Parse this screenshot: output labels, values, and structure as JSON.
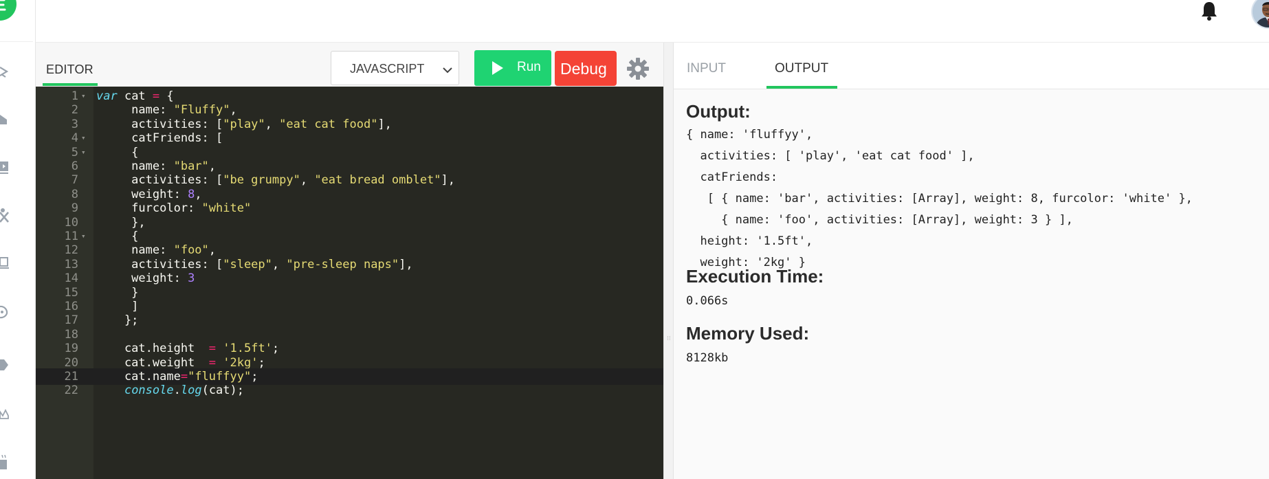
{
  "header": {
    "bell_icon": "bell-icon",
    "avatar_icon": "user-avatar"
  },
  "rail": {
    "icons": [
      "logo-icon",
      "rocket-icon",
      "home-icon",
      "video-icon",
      "tools-icon",
      "laptop-icon",
      "gauge-icon",
      "tag-icon",
      "crown-icon",
      "coffee-icon"
    ]
  },
  "editor": {
    "tab_label": "EDITOR",
    "language": "JAVASCRIPT",
    "run_label": "Run",
    "debug_label": "Debug",
    "lines": [
      {
        "n": "1",
        "fold": true
      },
      {
        "n": "2"
      },
      {
        "n": "3"
      },
      {
        "n": "4",
        "fold": true
      },
      {
        "n": "5",
        "fold": true
      },
      {
        "n": "6"
      },
      {
        "n": "7"
      },
      {
        "n": "8"
      },
      {
        "n": "9"
      },
      {
        "n": "10"
      },
      {
        "n": "11",
        "fold": true
      },
      {
        "n": "12"
      },
      {
        "n": "13"
      },
      {
        "n": "14"
      },
      {
        "n": "15"
      },
      {
        "n": "16"
      },
      {
        "n": "17"
      },
      {
        "n": "18"
      },
      {
        "n": "19"
      },
      {
        "n": "20"
      },
      {
        "n": "21",
        "active": true
      },
      {
        "n": "22"
      }
    ],
    "code": [
      [
        [
          "kw",
          "var"
        ],
        [
          "p",
          " cat "
        ],
        [
          "op",
          "="
        ],
        [
          "p",
          " {"
        ]
      ],
      [
        [
          "p",
          "     name: "
        ],
        [
          "str",
          "\"Fluffy\""
        ],
        [
          "p",
          ","
        ]
      ],
      [
        [
          "p",
          "     activities: ["
        ],
        [
          "str",
          "\"play\""
        ],
        [
          "p",
          ", "
        ],
        [
          "str",
          "\"eat cat food\""
        ],
        [
          "p",
          "],"
        ]
      ],
      [
        [
          "p",
          "     catFriends: ["
        ]
      ],
      [
        [
          "p",
          "     {"
        ]
      ],
      [
        [
          "p",
          "     name: "
        ],
        [
          "str",
          "\"bar\""
        ],
        [
          "p",
          ","
        ]
      ],
      [
        [
          "p",
          "     activities: ["
        ],
        [
          "str",
          "\"be grumpy\""
        ],
        [
          "p",
          ", "
        ],
        [
          "str",
          "\"eat bread omblet\""
        ],
        [
          "p",
          "],"
        ]
      ],
      [
        [
          "p",
          "     weight: "
        ],
        [
          "num",
          "8"
        ],
        [
          "p",
          ","
        ]
      ],
      [
        [
          "p",
          "     furcolor: "
        ],
        [
          "str",
          "\"white\""
        ]
      ],
      [
        [
          "p",
          "     },"
        ]
      ],
      [
        [
          "p",
          "     {"
        ]
      ],
      [
        [
          "p",
          "     name: "
        ],
        [
          "str",
          "\"foo\""
        ],
        [
          "p",
          ","
        ]
      ],
      [
        [
          "p",
          "     activities: ["
        ],
        [
          "str",
          "\"sleep\""
        ],
        [
          "p",
          ", "
        ],
        [
          "str",
          "\"pre-sleep naps\""
        ],
        [
          "p",
          "],"
        ]
      ],
      [
        [
          "p",
          "     weight: "
        ],
        [
          "num",
          "3"
        ]
      ],
      [
        [
          "p",
          "     }"
        ]
      ],
      [
        [
          "p",
          "     ]"
        ]
      ],
      [
        [
          "p",
          "    };"
        ]
      ],
      [
        [
          "p",
          ""
        ]
      ],
      [
        [
          "p",
          "    cat.height  "
        ],
        [
          "op",
          "="
        ],
        [
          "p",
          " "
        ],
        [
          "str",
          "'1.5ft'"
        ],
        [
          "p",
          ";"
        ]
      ],
      [
        [
          "p",
          "    cat.weight  "
        ],
        [
          "op",
          "="
        ],
        [
          "p",
          " "
        ],
        [
          "str",
          "'2kg'"
        ],
        [
          "p",
          ";"
        ]
      ],
      [
        [
          "p",
          "    cat.name"
        ],
        [
          "op",
          "="
        ],
        [
          "str",
          "\"fluffyy\""
        ],
        [
          "p",
          ";"
        ]
      ],
      [
        [
          "p",
          "    "
        ],
        [
          "fn",
          "console"
        ],
        [
          "p",
          "."
        ],
        [
          "fn2",
          "log"
        ],
        [
          "p",
          "(cat);"
        ]
      ]
    ]
  },
  "output": {
    "tab_input": "INPUT",
    "tab_output": "OUTPUT",
    "output_heading": "Output:",
    "output_lines": [
      "{ name: 'fluffyy',",
      "  activities: [ 'play', 'eat cat food' ],",
      "  catFriends:",
      "   [ { name: 'bar', activities: [Array], weight: 8, furcolor: 'white' },",
      "     { name: 'foo', activities: [Array], weight: 3 } ],",
      "  height: '1.5ft',",
      "  weight: '2kg' }"
    ],
    "exec_heading": "Execution Time:",
    "exec_value": "0.066s",
    "mem_heading": "Memory Used:",
    "mem_value": "8128kb"
  },
  "colors": {
    "accent_green": "#22c55e",
    "run_green": "#1fd372",
    "debug_red": "#f44336",
    "editor_bg": "#272822"
  }
}
